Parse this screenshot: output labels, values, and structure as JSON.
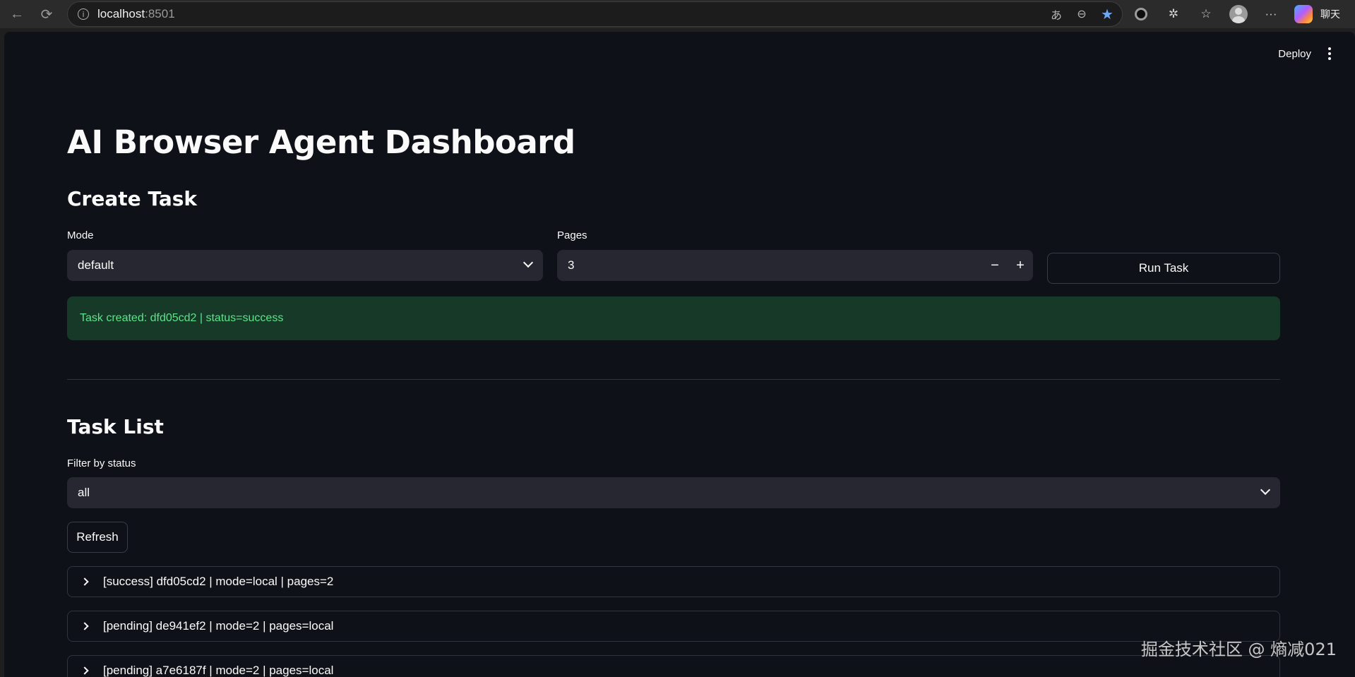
{
  "browser": {
    "url_host": "localhost",
    "url_port": ":8501",
    "chat_label": "聊天"
  },
  "header": {
    "deploy_label": "Deploy"
  },
  "page": {
    "title": "AI Browser Agent Dashboard"
  },
  "create_task": {
    "heading": "Create Task",
    "mode_label": "Mode",
    "mode_value": "default",
    "pages_label": "Pages",
    "pages_value": "3",
    "minus": "−",
    "plus": "+",
    "run_label": "Run Task",
    "alert_text": "Task created: dfd05cd2 | status=success"
  },
  "task_list": {
    "heading": "Task List",
    "filter_label": "Filter by status",
    "filter_value": "all",
    "refresh_label": "Refresh",
    "items": [
      "[success] dfd05cd2 | mode=local | pages=2",
      "[pending] de941ef2 | mode=2 | pages=local",
      "[pending] a7e6187f | mode=2 | pages=local"
    ]
  },
  "watermark": "掘金技术社区 @ 熵减021",
  "colors": {
    "app_bg": "#0e1117",
    "input_bg": "#262730",
    "success_bg": "#173928",
    "success_text": "#5ce488"
  }
}
